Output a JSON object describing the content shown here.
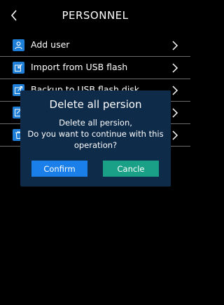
{
  "header": {
    "title": "PERSONNEL",
    "back_icon": "chevron-left-icon"
  },
  "menu": {
    "items": [
      {
        "label": "Add user",
        "icon": "user-icon"
      },
      {
        "label": "Import from USB flash",
        "icon": "import-icon"
      },
      {
        "label": "Backup to USB flash disk",
        "icon": "export-icon"
      },
      {
        "label": "",
        "icon": "edit-icon"
      },
      {
        "label": "",
        "icon": "trash-icon"
      }
    ]
  },
  "dialog": {
    "title": "Delete all persion",
    "message_line1": "Delete all persion,",
    "message_line2": "Do you want to continue with this",
    "message_line3": "operation?",
    "confirm_label": "Confirm",
    "cancel_label": "Cancle"
  },
  "colors": {
    "background": "#000000",
    "icon_blue": "#1f7ed6",
    "dialog_bg": "#0e2b4a",
    "confirm_blue": "#1a7fe8",
    "cancel_teal": "#1aa086"
  }
}
